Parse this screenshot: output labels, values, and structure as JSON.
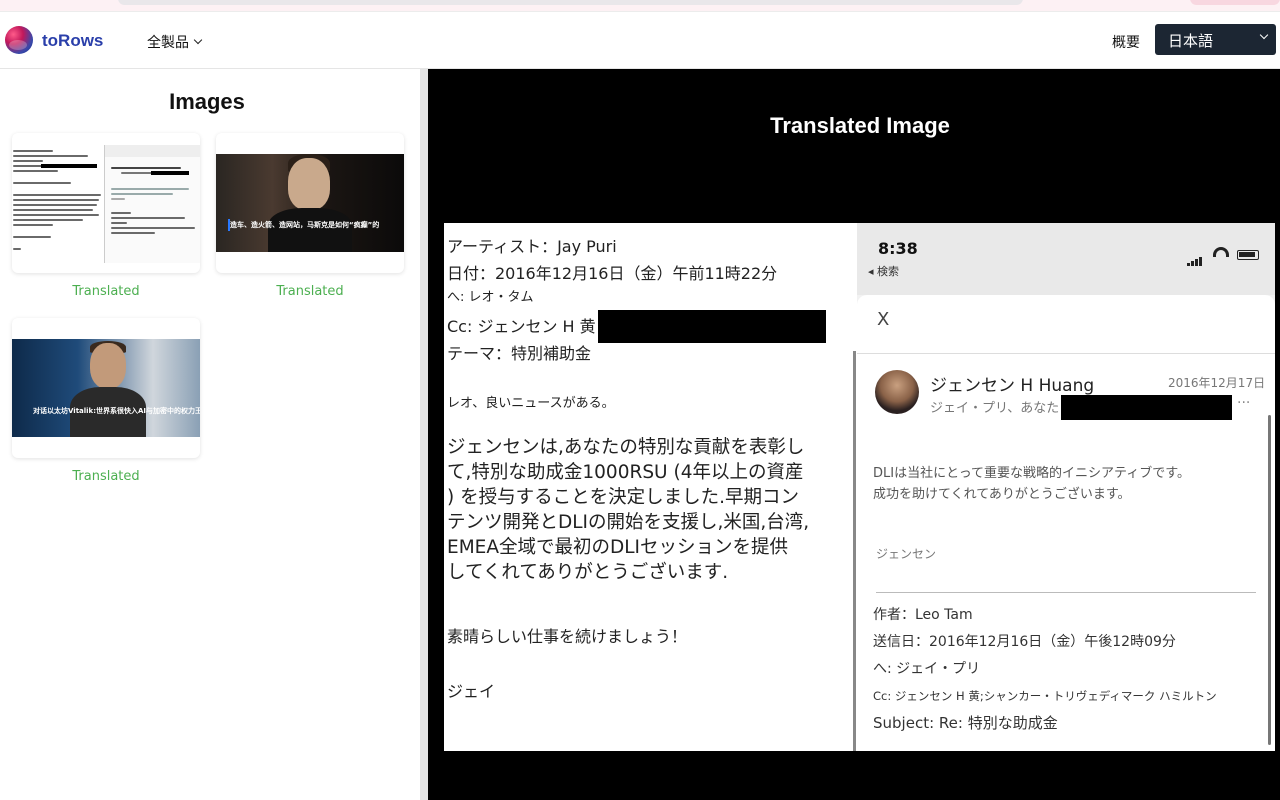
{
  "header": {
    "brand": "toRows",
    "products_label": "全製品",
    "about_label": "概要",
    "language_selected": "日本語"
  },
  "left_panel": {
    "title": "Images",
    "thumbnails": [
      {
        "status": "Translated"
      },
      {
        "status": "Translated",
        "caption": "造车、造火箭、造网站，马斯克是如何“疯癫”的"
      },
      {
        "status": "Translated",
        "caption": "对话以太坊Vitalik:世界系很快入AI与加密中的权力王国"
      }
    ]
  },
  "right_panel": {
    "title": "Translated Image",
    "email_left": {
      "from_line": "アーティスト：Jay Puri",
      "date_line": "日付：2016年12月16日（金）午前11時22分",
      "to_line": "へ: レオ・タム",
      "cc_line": "Cc: ジェンセン H 黄",
      "subject_line": "テーマ：特別補助金",
      "greeting": "レオ、良いニュースがある。",
      "body": [
        "ジェンセンは,あなたの特別な貢献を表彰し",
        "て,特別な助成金1000RSU (4年以上の資産",
        ") を授与することを決定しました.早期コン",
        "テンツ開発とDLIの開始を支援し,米国,台湾,",
        "EMEA全域で最初のDLIセッションを提供",
        "してくれてありがとうございます."
      ],
      "closing": "素晴らしい仕事を続けましょう！",
      "signature": "ジェイ"
    },
    "phone": {
      "time": "8:38",
      "back_label": "◂ 検索",
      "close": "X",
      "sender": "ジェンセン H Huang",
      "date": "2016年12月17日",
      "to": "ジェイ・プリ、あなた",
      "more": "···",
      "body": [
        "DLIは当社にとって重要な戦略的イニシアティブです。",
        "成功を助けてくれてありがとうございます。"
      ],
      "sign": "ジェンセン",
      "meta": {
        "author": "作者：Leo Tam",
        "sent": "送信日：2016年12月16日（金）午後12時09分",
        "to": "へ: ジェイ・プリ",
        "cc": "Cc: ジェンセン H 黄;シャンカー・トリヴェディマーク ハミルトン",
        "subject": "Subject: Re: 特別な助成金"
      }
    }
  }
}
